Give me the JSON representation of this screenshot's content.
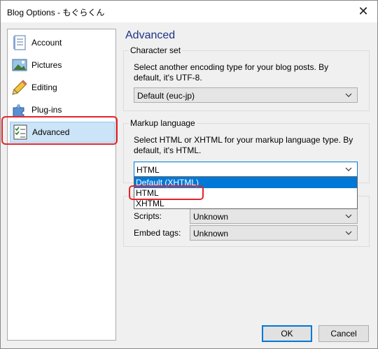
{
  "window": {
    "title": "Blog Options - もぐらくん",
    "close_glyph": "✕"
  },
  "sidebar": {
    "items": [
      {
        "label": "Account",
        "icon": "account-icon"
      },
      {
        "label": "Pictures",
        "icon": "pictures-icon"
      },
      {
        "label": "Editing",
        "icon": "editing-icon"
      },
      {
        "label": "Plug-ins",
        "icon": "plugins-icon"
      },
      {
        "label": "Advanced",
        "icon": "advanced-icon",
        "selected": true
      }
    ]
  },
  "main": {
    "heading": "Advanced",
    "charset": {
      "group_title": "Character set",
      "description": "Select another encoding type for your blog posts. By default, it's UTF-8.",
      "value": "Default (euc-jp)"
    },
    "markup": {
      "group_title": "Markup language",
      "description": "Select HTML or XHTML for your markup language type. By default, it's HTML.",
      "value": "HTML",
      "options": [
        "Default (XHTML)",
        "HTML",
        "XHTML"
      ],
      "hovered_option": "Default (XHTML)"
    },
    "other": {
      "scripts_label": "Scripts:",
      "scripts_value": "Unknown",
      "embed_label": "Embed tags:",
      "embed_value": "Unknown"
    }
  },
  "buttons": {
    "ok": "OK",
    "cancel": "Cancel"
  },
  "colors": {
    "heading": "#1e3287",
    "accent": "#0078d7",
    "annotation": "#e3242b",
    "selection": "#cce4f7"
  }
}
